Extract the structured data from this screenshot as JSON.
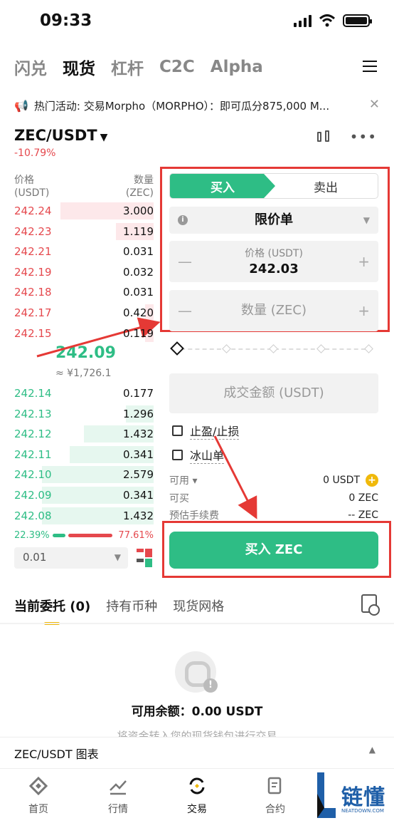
{
  "status": {
    "time": "09:33"
  },
  "top_tabs": [
    "闪兑",
    "现货",
    "杠杆",
    "C2C",
    "Alpha"
  ],
  "banner": {
    "text": "热门活动: 交易Morpho（MORPHO）：即可瓜分875,000 M..."
  },
  "pair": {
    "name": "ZEC/USDT",
    "change": "-10.79%"
  },
  "orderbook": {
    "price_header": "价格",
    "price_unit": "(USDT)",
    "qty_header": "数量",
    "qty_unit": "(ZEC)",
    "asks": [
      {
        "price": "242.24",
        "qty": "3.000",
        "depth": 0.67
      },
      {
        "price": "242.23",
        "qty": "1.119",
        "depth": 0.27
      },
      {
        "price": "242.21",
        "qty": "0.031",
        "depth": 0.0
      },
      {
        "price": "242.19",
        "qty": "0.032",
        "depth": 0.0
      },
      {
        "price": "242.18",
        "qty": "0.031",
        "depth": 0.0
      },
      {
        "price": "242.17",
        "qty": "0.420",
        "depth": 0.06
      },
      {
        "price": "242.15",
        "qty": "0.119",
        "depth": 0.06
      }
    ],
    "mid_price": "242.09",
    "mid_fiat": "≈ ¥1,726.1",
    "bids": [
      {
        "price": "242.14",
        "qty": "0.177",
        "depth": 0.0
      },
      {
        "price": "242.13",
        "qty": "1.296",
        "depth": 0.2
      },
      {
        "price": "242.12",
        "qty": "1.432",
        "depth": 0.5
      },
      {
        "price": "242.11",
        "qty": "0.341",
        "depth": 0.6
      },
      {
        "price": "242.10",
        "qty": "2.579",
        "depth": 0.8
      },
      {
        "price": "242.09",
        "qty": "0.341",
        "depth": 0.8
      },
      {
        "price": "242.08",
        "qty": "1.432",
        "depth": 0.8
      }
    ],
    "buy_ratio": "22.39%",
    "sell_ratio": "77.61%",
    "precision": "0.01"
  },
  "form": {
    "buy_tab": "买入",
    "sell_tab": "卖出",
    "order_type": "限价单",
    "price_label": "价格 (USDT)",
    "price_value": "242.03",
    "qty_placeholder": "数量 (ZEC)",
    "amount_placeholder": "成交金额 (USDT)",
    "tpsl": "止盈/止损",
    "iceberg": "冰山单",
    "available_label": "可用 ▾",
    "available_value": "0 USDT",
    "can_buy_label": "可买",
    "can_buy_value": "0 ZEC",
    "fee_label": "预估手续费",
    "fee_value": "-- ZEC",
    "buy_button": "买入 ZEC"
  },
  "bottom_tabs": [
    "当前委托 (0)",
    "持有币种",
    "现货网格"
  ],
  "empty": {
    "balance": "可用余额：0.00 USDT",
    "hint": "将资金转入您的现货钱包进行交易"
  },
  "chart_bar": {
    "label": "ZEC/USDT 图表"
  },
  "nav": [
    "首页",
    "行情",
    "交易",
    "合约"
  ],
  "watermark": {
    "text": "链懂",
    "sub": "NEATDOWN.COM"
  },
  "colors": {
    "green": "#2ebd85",
    "red": "#e5484d",
    "annotation": "#e53935",
    "accent": "#f0b90b"
  }
}
